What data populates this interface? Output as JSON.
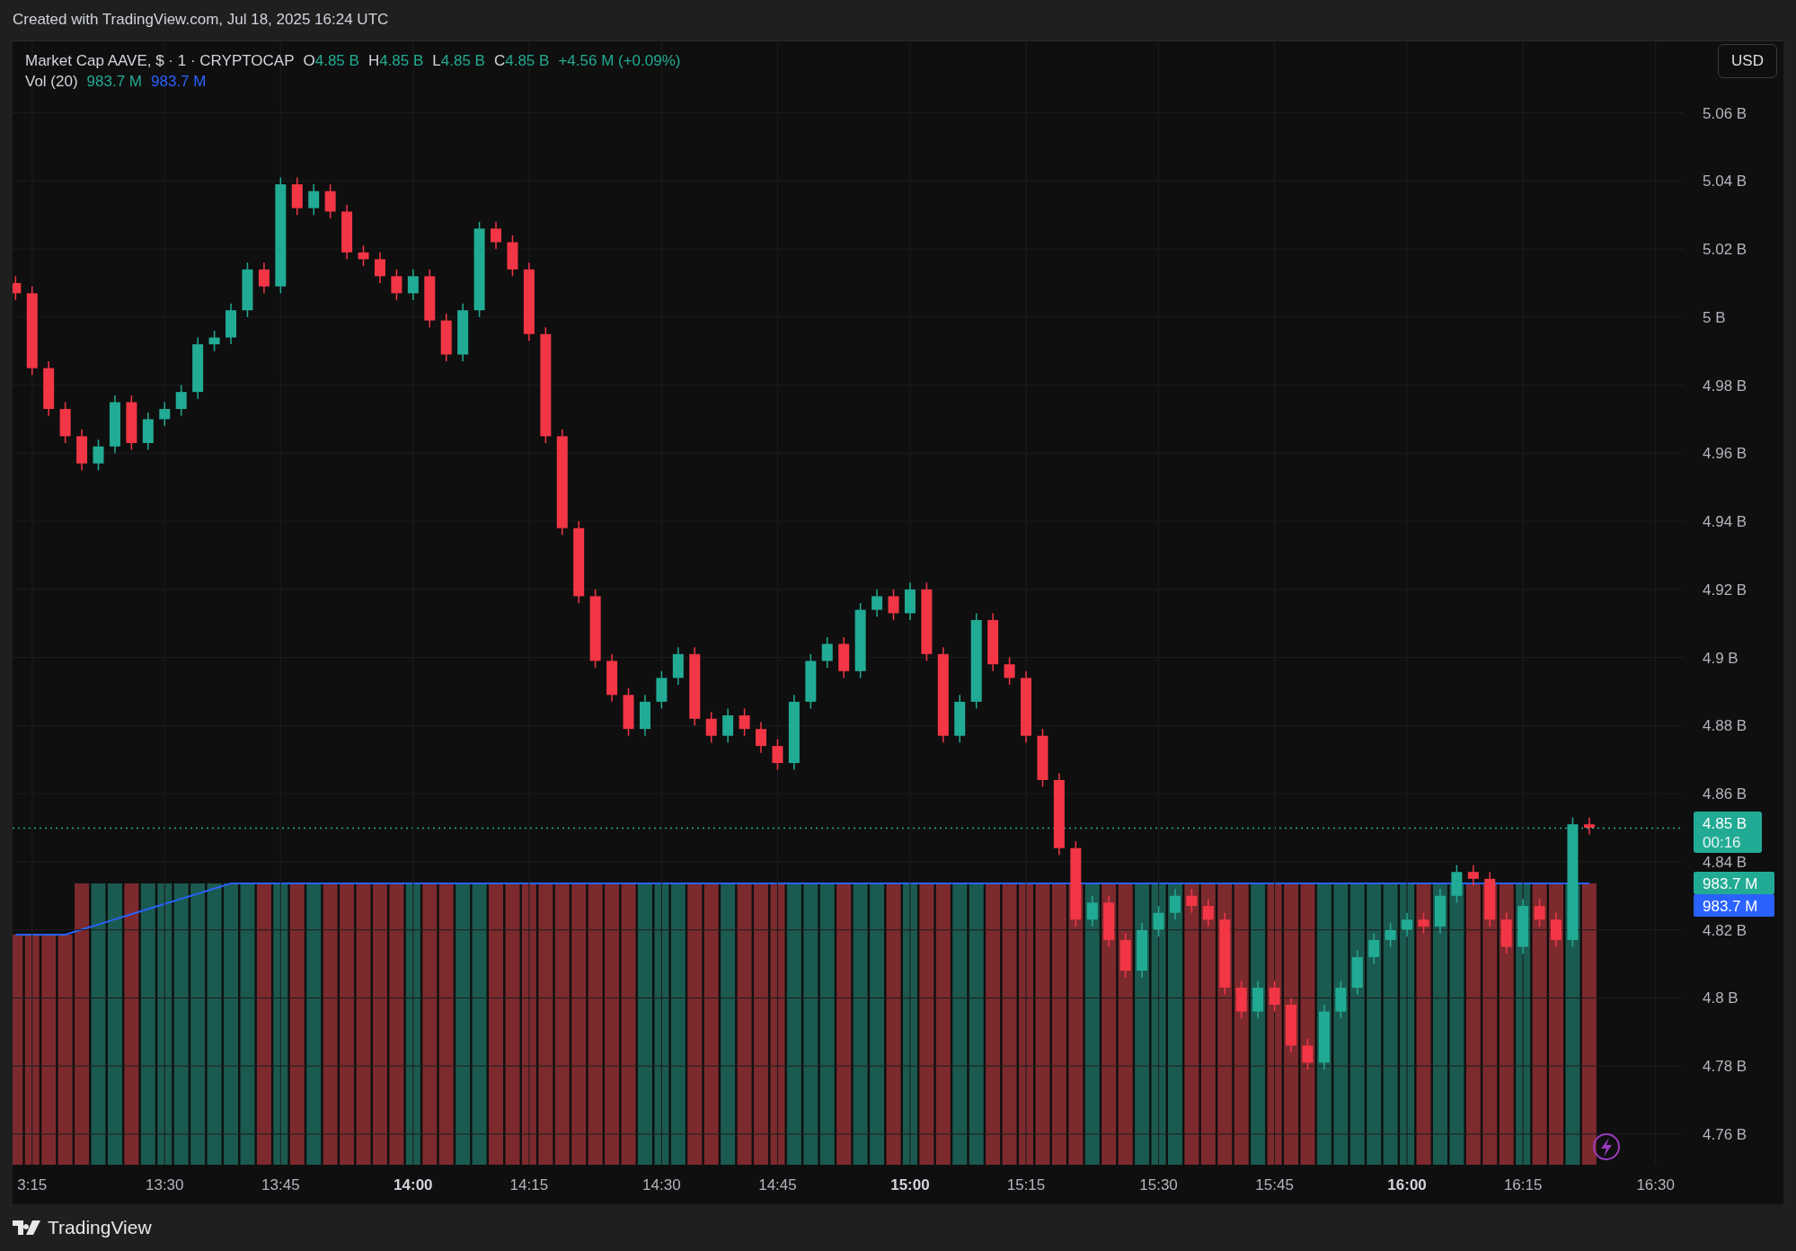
{
  "header": {
    "caption": "Created with TradingView.com, Jul 18, 2025 16:24 UTC"
  },
  "legend": {
    "symbol": "Market Cap AAVE, $ · 1 · CRYPTOCAP",
    "ohlc": [
      {
        "key": "O",
        "value": "4.85 B"
      },
      {
        "key": "H",
        "value": "4.85 B"
      },
      {
        "key": "L",
        "value": "4.85 B"
      },
      {
        "key": "C",
        "value": "4.85 B"
      }
    ],
    "change": "+4.56 M (+0.09%)",
    "volume": {
      "label": "Vol (20)",
      "values": [
        {
          "text": "983.7 M",
          "color": "#22ab94"
        },
        {
          "text": "983.7 M",
          "color": "#2962ff"
        }
      ]
    }
  },
  "currency_button": {
    "label": "USD"
  },
  "price_tag": {
    "price": "4.85 B",
    "countdown": "00:16"
  },
  "volume_tags": [
    {
      "text": "983.7 M",
      "color": "#22ab94"
    },
    {
      "text": "983.7 M",
      "color": "#2962ff"
    }
  ],
  "time_axis": [
    {
      "bold": false
    },
    {
      "bold": false
    },
    {
      "bold": false
    },
    {
      "bold": true
    },
    {
      "bold": false
    },
    {
      "bold": false
    },
    {
      "bold": false
    },
    {
      "bold": true
    },
    {
      "bold": false
    },
    {
      "bold": false
    },
    {
      "bold": false
    },
    {
      "bold": true
    },
    {
      "bold": false
    },
    {
      "bold": false
    }
  ],
  "chart_data": {
    "type": "candlestick",
    "grid": true,
    "ylim": [
      4.751,
      5.081
    ],
    "yticks": [
      {
        "value": 5.06,
        "label": "5.06 B"
      },
      {
        "value": 5.04,
        "label": "5.04 B"
      },
      {
        "value": 5.02,
        "label": "5.02 B"
      },
      {
        "value": 5.0,
        "label": "5 B"
      },
      {
        "value": 4.98,
        "label": "4.98 B"
      },
      {
        "value": 4.96,
        "label": "4.96 B"
      },
      {
        "value": 4.94,
        "label": "4.94 B"
      },
      {
        "value": 4.92,
        "label": "4.92 B"
      },
      {
        "value": 4.9,
        "label": "4.9 B"
      },
      {
        "value": 4.88,
        "label": "4.88 B"
      },
      {
        "value": 4.86,
        "label": "4.86 B"
      },
      {
        "value": 4.84,
        "label": "4.84 B"
      },
      {
        "value": 4.82,
        "label": "4.82 B"
      },
      {
        "value": 4.8,
        "label": "4.8 B"
      },
      {
        "value": 4.78,
        "label": "4.78 B"
      },
      {
        "value": 4.76,
        "label": "4.76 B"
      }
    ],
    "categories": [
      null,
      "3:15",
      null,
      null,
      null,
      null,
      null,
      null,
      null,
      "13:30",
      null,
      null,
      null,
      null,
      null,
      null,
      "13:45",
      null,
      null,
      null,
      null,
      null,
      null,
      null,
      "14:00",
      null,
      null,
      null,
      null,
      null,
      null,
      "14:15",
      null,
      null,
      null,
      null,
      null,
      null,
      null,
      "14:30",
      null,
      null,
      null,
      null,
      null,
      null,
      "14:45",
      null,
      null,
      null,
      null,
      null,
      null,
      null,
      "15:00",
      null,
      null,
      null,
      null,
      null,
      null,
      "15:15",
      null,
      null,
      null,
      null,
      null,
      null,
      null,
      "15:30",
      null,
      null,
      null,
      null,
      null,
      null,
      "15:45",
      null,
      null,
      null,
      null,
      null,
      null,
      null,
      "16:00",
      null,
      null,
      null,
      null,
      null,
      null,
      "16:15",
      null,
      null,
      null,
      null,
      null,
      null,
      null,
      "16:30"
    ],
    "ohlc": [
      [
        5.01,
        5.012,
        5.005,
        5.007
      ],
      [
        5.007,
        5.009,
        4.983,
        4.985
      ],
      [
        4.985,
        4.987,
        4.971,
        4.973
      ],
      [
        4.973,
        4.975,
        4.963,
        4.965
      ],
      [
        4.965,
        4.967,
        4.955,
        4.957
      ],
      [
        4.957,
        4.964,
        4.955,
        4.962
      ],
      [
        4.962,
        4.977,
        4.96,
        4.975
      ],
      [
        4.975,
        4.977,
        4.961,
        4.963
      ],
      [
        4.963,
        4.972,
        4.961,
        4.97
      ],
      [
        4.97,
        4.975,
        4.968,
        4.973
      ],
      [
        4.973,
        4.98,
        4.971,
        4.978
      ],
      [
        4.978,
        4.994,
        4.976,
        4.992
      ],
      [
        4.992,
        4.996,
        4.99,
        4.994
      ],
      [
        4.994,
        5.004,
        4.992,
        5.002
      ],
      [
        5.002,
        5.016,
        5.0,
        5.014
      ],
      [
        5.014,
        5.016,
        5.007,
        5.009
      ],
      [
        5.009,
        5.041,
        5.007,
        5.039
      ],
      [
        5.039,
        5.041,
        5.03,
        5.032
      ],
      [
        5.032,
        5.039,
        5.03,
        5.037
      ],
      [
        5.037,
        5.039,
        5.029,
        5.031
      ],
      [
        5.031,
        5.033,
        5.017,
        5.019
      ],
      [
        5.019,
        5.021,
        5.015,
        5.017
      ],
      [
        5.017,
        5.019,
        5.01,
        5.012
      ],
      [
        5.012,
        5.014,
        5.005,
        5.007
      ],
      [
        5.007,
        5.014,
        5.005,
        5.012
      ],
      [
        5.012,
        5.014,
        4.997,
        4.999
      ],
      [
        4.999,
        5.001,
        4.987,
        4.989
      ],
      [
        4.989,
        5.004,
        4.987,
        5.002
      ],
      [
        5.002,
        5.028,
        5.0,
        5.026
      ],
      [
        5.026,
        5.028,
        5.02,
        5.022
      ],
      [
        5.022,
        5.024,
        5.012,
        5.014
      ],
      [
        5.014,
        5.016,
        4.993,
        4.995
      ],
      [
        4.995,
        4.997,
        4.963,
        4.965
      ],
      [
        4.965,
        4.967,
        4.936,
        4.938
      ],
      [
        4.938,
        4.94,
        4.916,
        4.918
      ],
      [
        4.918,
        4.92,
        4.897,
        4.899
      ],
      [
        4.899,
        4.901,
        4.887,
        4.889
      ],
      [
        4.889,
        4.891,
        4.877,
        4.879
      ],
      [
        4.879,
        4.889,
        4.877,
        4.887
      ],
      [
        4.887,
        4.896,
        4.885,
        4.894
      ],
      [
        4.894,
        4.903,
        4.892,
        4.901
      ],
      [
        4.901,
        4.903,
        4.88,
        4.882
      ],
      [
        4.882,
        4.884,
        4.875,
        4.877
      ],
      [
        4.877,
        4.885,
        4.875,
        4.883
      ],
      [
        4.883,
        4.885,
        4.877,
        4.879
      ],
      [
        4.879,
        4.881,
        4.872,
        4.874
      ],
      [
        4.874,
        4.876,
        4.867,
        4.869
      ],
      [
        4.869,
        4.889,
        4.867,
        4.887
      ],
      [
        4.887,
        4.901,
        4.885,
        4.899
      ],
      [
        4.899,
        4.906,
        4.897,
        4.904
      ],
      [
        4.904,
        4.906,
        4.894,
        4.896
      ],
      [
        4.896,
        4.916,
        4.894,
        4.914
      ],
      [
        4.914,
        4.92,
        4.912,
        4.918
      ],
      [
        4.918,
        4.92,
        4.911,
        4.913
      ],
      [
        4.913,
        4.922,
        4.911,
        4.92
      ],
      [
        4.92,
        4.922,
        4.899,
        4.901
      ],
      [
        4.901,
        4.903,
        4.875,
        4.877
      ],
      [
        4.877,
        4.889,
        4.875,
        4.887
      ],
      [
        4.887,
        4.913,
        4.885,
        4.911
      ],
      [
        4.911,
        4.913,
        4.896,
        4.898
      ],
      [
        4.898,
        4.9,
        4.892,
        4.894
      ],
      [
        4.894,
        4.896,
        4.875,
        4.877
      ],
      [
        4.877,
        4.879,
        4.862,
        4.864
      ],
      [
        4.864,
        4.866,
        4.842,
        4.844
      ],
      [
        4.844,
        4.846,
        4.821,
        4.823
      ],
      [
        4.823,
        4.83,
        4.821,
        4.828
      ],
      [
        4.828,
        4.83,
        4.815,
        4.817
      ],
      [
        4.817,
        4.819,
        4.806,
        4.808
      ],
      [
        4.808,
        4.822,
        4.806,
        4.82
      ],
      [
        4.82,
        4.827,
        4.818,
        4.825
      ],
      [
        4.825,
        4.832,
        4.823,
        4.83
      ],
      [
        4.83,
        4.832,
        4.825,
        4.827
      ],
      [
        4.827,
        4.829,
        4.821,
        4.823
      ],
      [
        4.823,
        4.825,
        4.801,
        4.803
      ],
      [
        4.803,
        4.805,
        4.794,
        4.796
      ],
      [
        4.796,
        4.805,
        4.794,
        4.803
      ],
      [
        4.803,
        4.805,
        4.796,
        4.798
      ],
      [
        4.798,
        4.8,
        4.784,
        4.786
      ],
      [
        4.786,
        4.788,
        4.779,
        4.781
      ],
      [
        4.781,
        4.798,
        4.779,
        4.796
      ],
      [
        4.796,
        4.805,
        4.794,
        4.803
      ],
      [
        4.803,
        4.814,
        4.801,
        4.812
      ],
      [
        4.812,
        4.819,
        4.81,
        4.817
      ],
      [
        4.817,
        4.822,
        4.815,
        4.82
      ],
      [
        4.82,
        4.825,
        4.818,
        4.823
      ],
      [
        4.823,
        4.825,
        4.819,
        4.821
      ],
      [
        4.821,
        4.832,
        4.819,
        4.83
      ],
      [
        4.83,
        4.839,
        4.828,
        4.837
      ],
      [
        4.837,
        4.839,
        4.833,
        4.835
      ],
      [
        4.835,
        4.837,
        4.821,
        4.823
      ],
      [
        4.823,
        4.825,
        4.813,
        4.815
      ],
      [
        4.815,
        4.829,
        4.813,
        4.827
      ],
      [
        4.827,
        4.829,
        4.821,
        4.823
      ],
      [
        4.823,
        4.825,
        4.815,
        4.817
      ],
      [
        4.817,
        4.853,
        4.815,
        4.851
      ],
      [
        4.851,
        4.853,
        4.848,
        4.85
      ],
      null,
      null,
      null,
      null
    ]
  },
  "footer": {
    "brand": "TradingView"
  }
}
